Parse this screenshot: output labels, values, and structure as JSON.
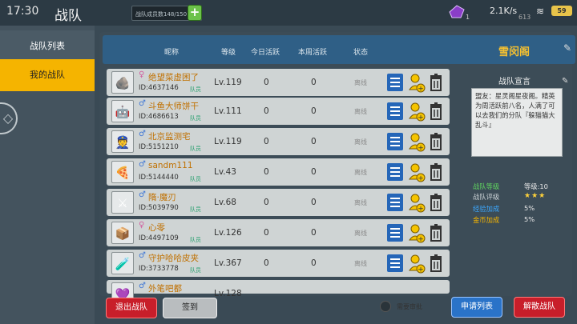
{
  "status_bar": {
    "time": "17:30",
    "speed": "2.1K/s",
    "coins": "613",
    "battery": "59",
    "gem_count": "1"
  },
  "header": {
    "title": "战队",
    "member_count": "战队成员数148/150",
    "plus": "+"
  },
  "sidebar": {
    "items": [
      {
        "label": "战队列表"
      },
      {
        "label": "我的战队"
      }
    ]
  },
  "table": {
    "columns": [
      "昵称",
      "等级",
      "今日活跃",
      "本周活跃",
      "状态"
    ],
    "team_name": "雪闵阁",
    "rows": [
      {
        "name": "绝望菜虚困了",
        "gender": "♀",
        "id": "ID:4637146",
        "role": "队员",
        "level": "Lv.119",
        "today": "0",
        "week": "0",
        "status": "离线",
        "avatar": "🪨"
      },
      {
        "name": "斗鱼大师饼干",
        "gender": "♂",
        "id": "ID:4686613",
        "role": "队员",
        "level": "Lv.111",
        "today": "0",
        "week": "0",
        "status": "离线",
        "avatar": "🤖"
      },
      {
        "name": "北京监测宅",
        "gender": "♂",
        "id": "ID:5151210",
        "role": "队员",
        "level": "Lv.119",
        "today": "0",
        "week": "0",
        "status": "离线",
        "avatar": "👮"
      },
      {
        "name": "sandm111",
        "gender": "♂",
        "id": "ID:5144440",
        "role": "队员",
        "level": "Lv.43",
        "today": "0",
        "week": "0",
        "status": "离线",
        "avatar": "🍕"
      },
      {
        "name": "隋·魔刃",
        "gender": "♂",
        "id": "ID:5039790",
        "role": "队员",
        "level": "Lv.68",
        "today": "0",
        "week": "0",
        "status": "离线",
        "avatar": "⚔"
      },
      {
        "name": "心零",
        "gender": "♀",
        "id": "ID:4497109",
        "role": "队员",
        "level": "Lv.126",
        "today": "0",
        "week": "0",
        "status": "离线",
        "avatar": "📦"
      },
      {
        "name": "守护哈哈皮夹",
        "gender": "♂",
        "id": "ID:3733778",
        "role": "队员",
        "level": "Lv.367",
        "today": "0",
        "week": "0",
        "status": "离线",
        "avatar": "🧪"
      },
      {
        "name": "外笔吧都",
        "gender": "♂",
        "id": "",
        "role": "",
        "level": "Lv.128",
        "today": "",
        "week": "",
        "status": "",
        "avatar": "💜"
      }
    ]
  },
  "info": {
    "title": "战队宣言",
    "declaration": "盟友：星灵阁星夜阁。精英为周活跃前八名，人满了可以去我们的分队『躲猫猫大乱斗』",
    "stats": [
      {
        "label": "战队等级",
        "value": "等级:10",
        "color": "#5fd35f"
      },
      {
        "label": "战队评级",
        "value": "★★★",
        "color": "#c9d0d4"
      },
      {
        "label": "经验加成",
        "value": "5%",
        "color": "#3ba8ff"
      },
      {
        "label": "金币加成",
        "value": "5%",
        "color": "#f5b400"
      }
    ]
  },
  "footer": {
    "quit": "退出战队",
    "sign": "签到",
    "approve": "需要审批",
    "apply_list": "申请列表",
    "disband": "解散战队"
  }
}
